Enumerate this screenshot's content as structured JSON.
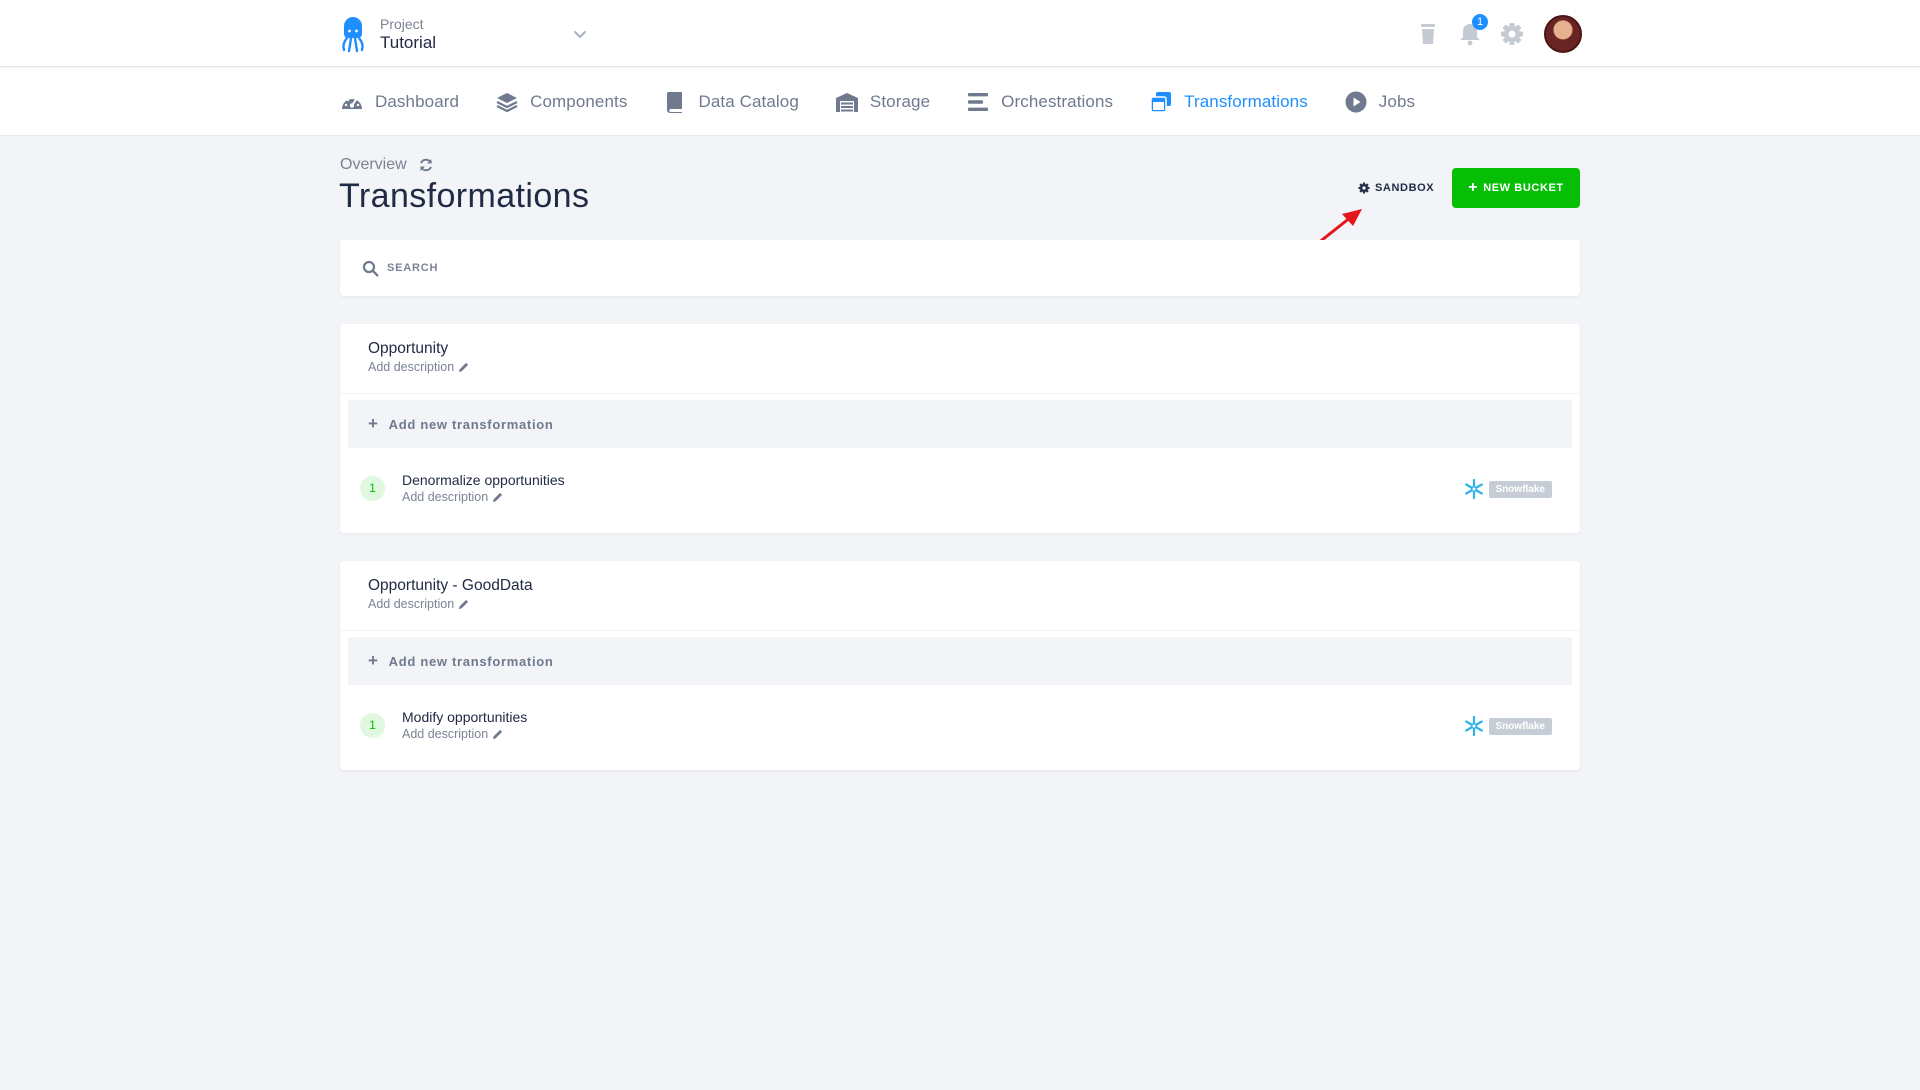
{
  "project": {
    "label": "Project",
    "name": "Tutorial"
  },
  "notifications": {
    "count": "1"
  },
  "nav": [
    {
      "label": "Dashboard",
      "icon": "dashboard-icon"
    },
    {
      "label": "Components",
      "icon": "layers-icon"
    },
    {
      "label": "Data Catalog",
      "icon": "book-icon"
    },
    {
      "label": "Storage",
      "icon": "warehouse-icon"
    },
    {
      "label": "Orchestrations",
      "icon": "bars-icon"
    },
    {
      "label": "Transformations",
      "icon": "window-restore-icon",
      "active": true
    },
    {
      "label": "Jobs",
      "icon": "play-circle-icon"
    }
  ],
  "header": {
    "breadcrumb": "Overview",
    "title": "Transformations",
    "sandbox_label": "SANDBOX",
    "new_bucket_label": "NEW BUCKET"
  },
  "search": {
    "placeholder": "SEARCH"
  },
  "buckets": [
    {
      "name": "Opportunity",
      "description": "Add description",
      "add_label": "Add new transformation",
      "transformations": [
        {
          "phase": "1",
          "name": "Denormalize opportunities",
          "description": "Add description",
          "backend": "Snowflake"
        }
      ]
    },
    {
      "name": "Opportunity - GoodData",
      "description": "Add description",
      "add_label": "Add new transformation",
      "transformations": [
        {
          "phase": "1",
          "name": "Modify opportunities",
          "description": "Add description",
          "backend": "Snowflake"
        }
      ]
    }
  ],
  "colors": {
    "accent": "#1f8fff",
    "success": "#07be07",
    "annotation_arrow": "#e8141b",
    "snowflake": "#29b5e8"
  }
}
